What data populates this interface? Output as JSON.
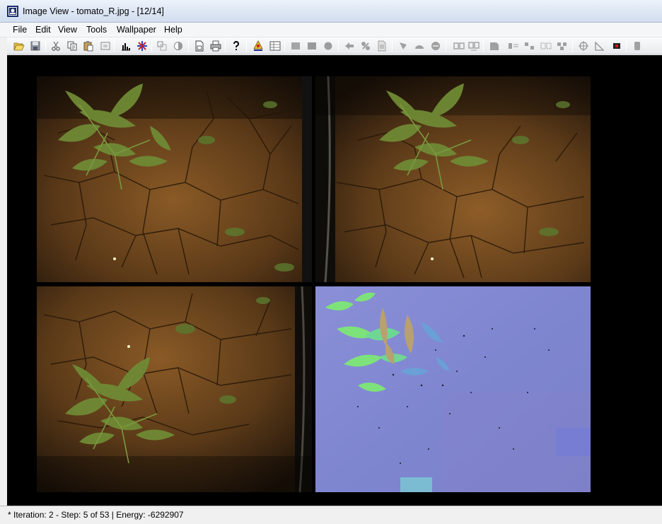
{
  "window": {
    "title": "Image View - tomato_R.jpg - [12/14]"
  },
  "menu": {
    "items": [
      {
        "id": "file",
        "label": "File"
      },
      {
        "id": "edit",
        "label": "Edit"
      },
      {
        "id": "view",
        "label": "View"
      },
      {
        "id": "tools",
        "label": "Tools"
      },
      {
        "id": "wallpaper",
        "label": "Wallpaper"
      },
      {
        "id": "help",
        "label": "Help"
      }
    ]
  },
  "toolbar": {
    "buttons": [
      {
        "name": "open-icon"
      },
      {
        "name": "save-icon"
      },
      {
        "name": "cut-icon"
      },
      {
        "name": "copy-icon"
      },
      {
        "name": "paste-icon"
      },
      {
        "name": "crop-icon"
      },
      {
        "name": "histogram-icon"
      },
      {
        "name": "color-balance-icon"
      },
      {
        "name": "resize-icon"
      },
      {
        "name": "contrast-icon"
      },
      {
        "name": "page-setup-icon"
      },
      {
        "name": "print-icon"
      },
      {
        "name": "help-icon"
      },
      {
        "name": "point-marker-icon"
      },
      {
        "name": "grid-marker-icon"
      },
      {
        "name": "rectangle-icon"
      },
      {
        "name": "filled-rectangle-icon"
      },
      {
        "name": "circle-icon"
      },
      {
        "name": "arrow-tool-icon"
      },
      {
        "name": "pointer-tool-icon"
      },
      {
        "name": "document-tool-icon"
      },
      {
        "name": "shape-tool-icon"
      },
      {
        "name": "triangle-tool-icon"
      },
      {
        "name": "omega-tool-icon"
      },
      {
        "name": "stereo-left-icon"
      },
      {
        "name": "stereo-right-icon"
      },
      {
        "name": "export-icon"
      },
      {
        "name": "layout-1-icon"
      },
      {
        "name": "layout-2-icon"
      },
      {
        "name": "layout-3-icon"
      },
      {
        "name": "rgb-icon"
      },
      {
        "name": "target-icon"
      },
      {
        "name": "measure-icon"
      },
      {
        "name": "record-icon"
      },
      {
        "name": "stop-icon"
      }
    ]
  },
  "panels": [
    {
      "name": "image-panel-top-left",
      "kind": "soil"
    },
    {
      "name": "image-panel-top-right",
      "kind": "soil"
    },
    {
      "name": "image-panel-bottom-left",
      "kind": "soil"
    },
    {
      "name": "image-panel-bottom-right",
      "kind": "disparity"
    }
  ],
  "status": {
    "text": "* Iteration: 2 - Step: 5 of 53 | Energy: -6292907"
  },
  "colors": {
    "viewport_bg": "#000000",
    "soil_base": "#5a3d1c",
    "disparity_base": "#7f86d0",
    "plant_green": "#5c7a2c"
  }
}
